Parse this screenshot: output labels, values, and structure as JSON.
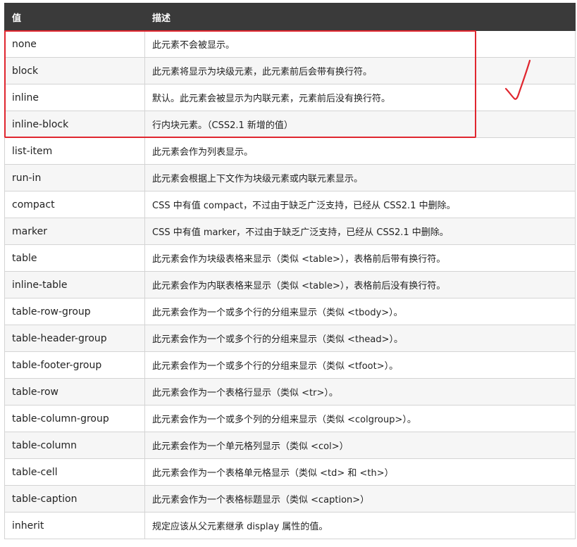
{
  "table": {
    "headers": [
      "值",
      "描述"
    ],
    "rows": [
      {
        "value": "none",
        "desc": "此元素不会被显示。"
      },
      {
        "value": "block",
        "desc": "此元素将显示为块级元素，此元素前后会带有换行符。"
      },
      {
        "value": "inline",
        "desc": "默认。此元素会被显示为内联元素，元素前后没有换行符。"
      },
      {
        "value": "inline-block",
        "desc": "行内块元素。（CSS2.1 新增的值）"
      },
      {
        "value": "list-item",
        "desc": "此元素会作为列表显示。"
      },
      {
        "value": "run-in",
        "desc": "此元素会根据上下文作为块级元素或内联元素显示。"
      },
      {
        "value": "compact",
        "desc": "CSS 中有值 compact，不过由于缺乏广泛支持，已经从 CSS2.1 中删除。"
      },
      {
        "value": "marker",
        "desc": "CSS 中有值 marker，不过由于缺乏广泛支持，已经从 CSS2.1 中删除。"
      },
      {
        "value": "table",
        "desc": "此元素会作为块级表格来显示（类似 <table>），表格前后带有换行符。"
      },
      {
        "value": "inline-table",
        "desc": "此元素会作为内联表格来显示（类似 <table>），表格前后没有换行符。"
      },
      {
        "value": "table-row-group",
        "desc": "此元素会作为一个或多个行的分组来显示（类似 <tbody>）。"
      },
      {
        "value": "table-header-group",
        "desc": "此元素会作为一个或多个行的分组来显示（类似 <thead>）。"
      },
      {
        "value": "table-footer-group",
        "desc": "此元素会作为一个或多个行的分组来显示（类似 <tfoot>）。"
      },
      {
        "value": "table-row",
        "desc": "此元素会作为一个表格行显示（类似 <tr>）。"
      },
      {
        "value": "table-column-group",
        "desc": "此元素会作为一个或多个列的分组来显示（类似 <colgroup>）。"
      },
      {
        "value": "table-column",
        "desc": "此元素会作为一个单元格列显示（类似 <col>）"
      },
      {
        "value": "table-cell",
        "desc": "此元素会作为一个表格单元格显示（类似 <td> 和 <th>）"
      },
      {
        "value": "table-caption",
        "desc": "此元素会作为一个表格标题显示（类似 <caption>）"
      },
      {
        "value": "inherit",
        "desc": "规定应该从父元素继承 display 属性的值。"
      }
    ]
  },
  "annotations": {
    "highlight_color": "#e0262f",
    "highlight_rows": [
      "none",
      "block",
      "inline",
      "inline-block"
    ],
    "checkmark_icon": "handwritten-checkmark-icon"
  },
  "colors": {
    "header_bg": "#3a3a3a",
    "header_text": "#ffffff",
    "row_alt_bg": "#f6f6f6",
    "border": "#d4d4d4"
  }
}
